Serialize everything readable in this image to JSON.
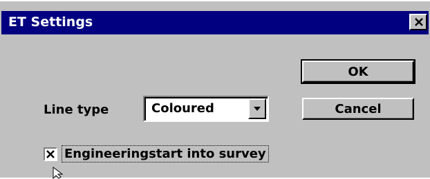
{
  "window": {
    "title": "ET Settings"
  },
  "buttons": {
    "ok": "OK",
    "cancel": "Cancel"
  },
  "line_type": {
    "label": "Line type",
    "value": "Coloured"
  },
  "engineering_start": {
    "label": "Engineeringstart into survey",
    "checked": true
  },
  "icons": [
    "close-icon",
    "chevron-down-icon",
    "checkmark-icon",
    "mouse-pointer-icon"
  ],
  "colors": {
    "titlebar": "#000080",
    "face": "#c0c0c0"
  }
}
